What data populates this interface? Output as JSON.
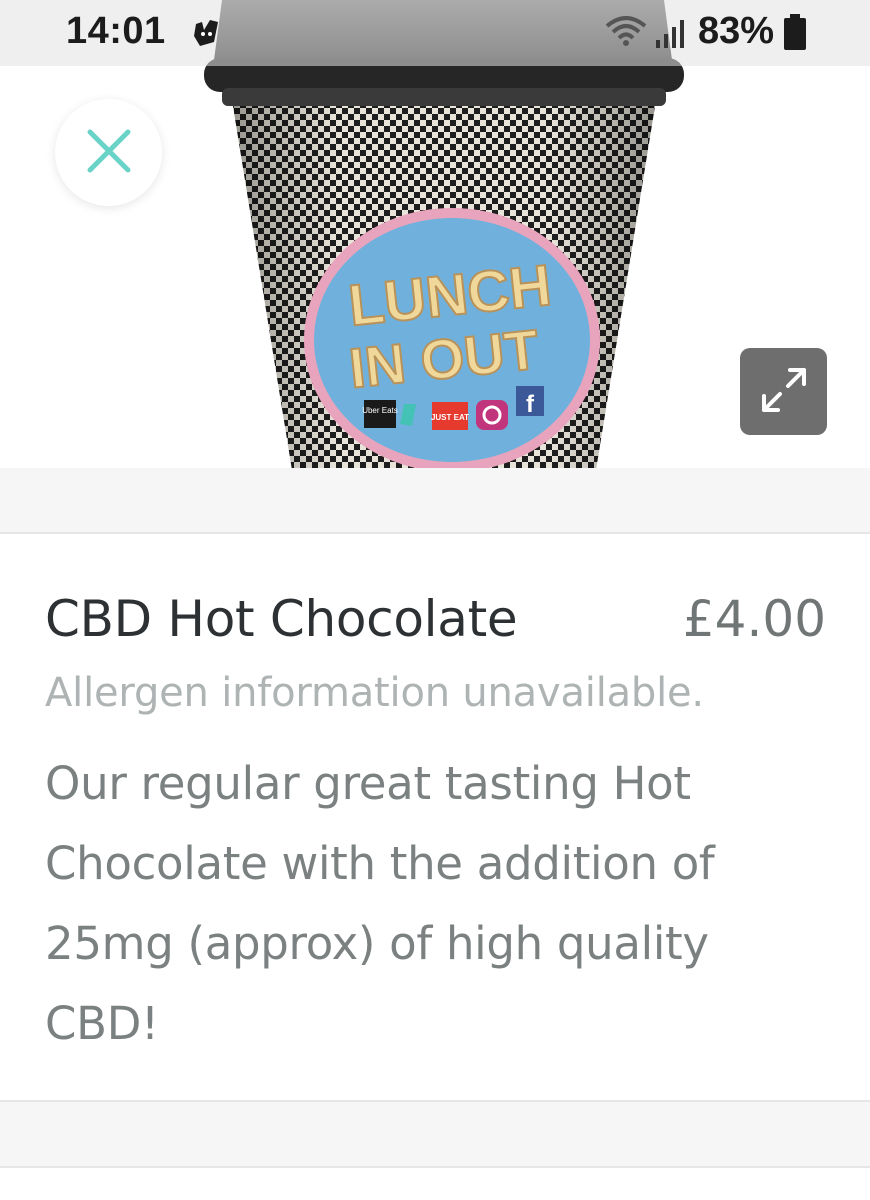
{
  "status_bar": {
    "time": "14:01",
    "app_icon": "deliveroo-icon",
    "wifi_icon": "wifi-icon",
    "signal_icon": "signal-icon",
    "battery_percent": "83%",
    "battery_icon": "battery-icon"
  },
  "hero": {
    "close_icon": "close-icon",
    "expand_icon": "expand-icon",
    "cup_logo": {
      "line1": "LUNCH",
      "line2": "IN OUT",
      "badges": [
        "Uber Eats",
        "JUST EAT"
      ]
    }
  },
  "product": {
    "name": "CBD Hot Chocolate",
    "price": "£4.00",
    "allergen_info": "Allergen information unavailable.",
    "description": "Our regular great tasting Hot Chocolate with the addition of 25mg (approx) of high quality CBD!"
  },
  "colors": {
    "accent_teal": "#69d3c8",
    "title_text": "#2d3133",
    "muted_text": "#7b8080",
    "allergen_text": "#aeb3b3"
  }
}
